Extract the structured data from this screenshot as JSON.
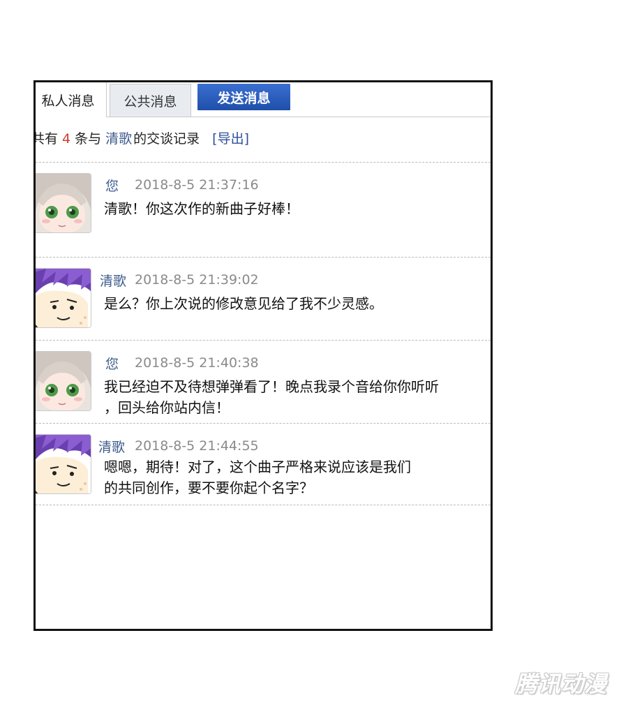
{
  "tabs": {
    "private": "私人消息",
    "public": "公共消息",
    "send": "发送消息"
  },
  "summary": {
    "prefix": "共有",
    "count": "4",
    "middle": "条与",
    "partner": "清歌",
    "suffix": "的交谈记录",
    "export": "[导出]"
  },
  "messages": [
    {
      "sender": "您",
      "time": "2018-8-5 21:37:16",
      "avatar": "girl-avatar-icon",
      "lines": [
        "清歌！你这次作的新曲子好棒！"
      ]
    },
    {
      "sender": "清歌",
      "time": "2018-8-5 21:39:02",
      "avatar": "boy-avatar-icon",
      "lines": [
        "是么？你上次说的修改意见给了我不少灵感。"
      ]
    },
    {
      "sender": "您",
      "time": "2018-8-5 21:40:38",
      "avatar": "girl-avatar-icon",
      "lines": [
        "我已经迫不及待想弹弹看了！晚点我录个音给你你听听",
        "，回头给你站内信！"
      ]
    },
    {
      "sender": "清歌",
      "time": "2018-8-5 21:44:55",
      "avatar": "boy-avatar-icon",
      "lines": [
        "嗯嗯，期待！对了，这个曲子严格来说应该是我们",
        "的共同创作，要不要你起个名字？"
      ]
    }
  ],
  "colors": {
    "tab_send_bg": "#2a5cbf",
    "link": "#3c5a8c",
    "count": "#d23b2f",
    "timestamp": "#8a8a8a"
  },
  "watermark": "腾讯动漫"
}
